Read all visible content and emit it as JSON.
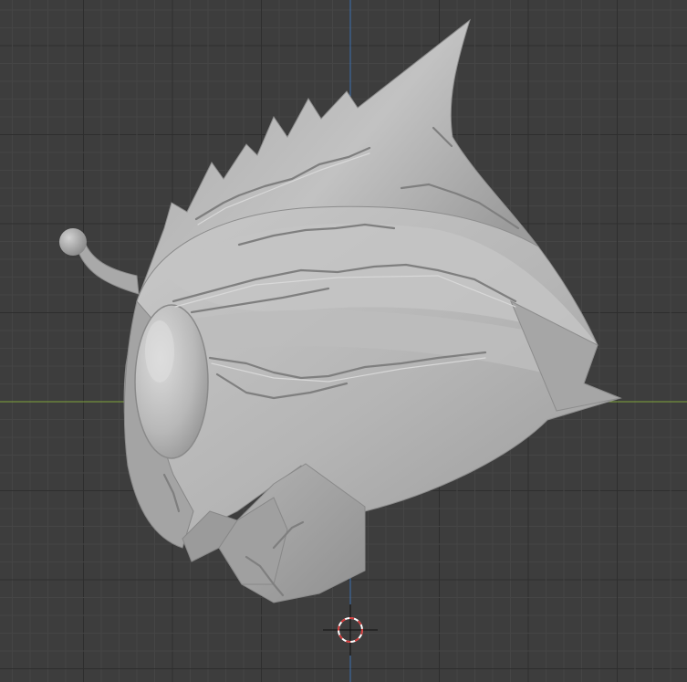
{
  "viewport": {
    "background_color": "#3d3d3d",
    "grid_minor_color": "#454545",
    "grid_major_color": "#2e2e2e"
  },
  "axes": {
    "x_axis": {
      "name": "x-axis",
      "color": "#7fa33a"
    },
    "z_axis": {
      "name": "z-axis",
      "color": "#3b6fb0"
    }
  },
  "model": {
    "name": "helmet-sculpt",
    "base_color": "#b9b9b9",
    "shadow_color": "#8f8f8f",
    "highlight_color": "#d6d6d6",
    "crack_color": "#7d7d7d"
  },
  "cursor": {
    "name": "3d-cursor",
    "ring_color_a": "#ffffff",
    "ring_color_b": "#d23b3b",
    "crosshair_color": "#111111"
  }
}
